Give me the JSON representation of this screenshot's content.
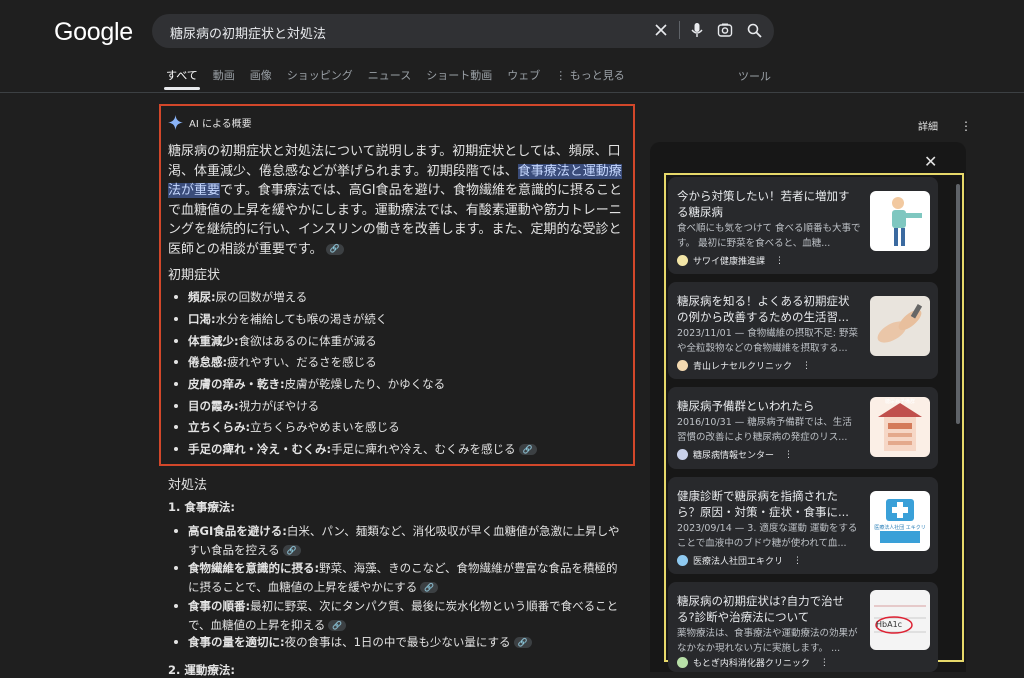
{
  "logo": "Google",
  "search": {
    "query": "糖尿病の初期症状と対処法"
  },
  "tabs": [
    "すべて",
    "動画",
    "画像",
    "ショッピング",
    "ニュース",
    "ショート動画",
    "ウェブ"
  ],
  "more_label": "もっと見る",
  "tools_label": "ツール",
  "ai": {
    "header": "AI による概要",
    "para_part1": "糖尿病の初期症状と対処法について説明します。初期症状としては、頻尿、口渇、体重減少、倦怠感などが挙げられます。初期段階では、",
    "para_highlight": "食事療法と運動療法が重要",
    "para_part2": "です。食事療法では、高GI食品を避け、食物繊維を意識的に摂ることで血糖値の上昇を緩やかにします。運動療法では、有酸素運動や筋力トレーニングを継続的に行い、インスリンの働きを改善します。また、定期的な受診と医師との相談が重要です。",
    "symptoms_title": "初期症状",
    "symptoms": [
      {
        "term": "頻尿:",
        "desc": "尿の回数が増える"
      },
      {
        "term": "口渇:",
        "desc": "水分を補給しても喉の渇きが続く"
      },
      {
        "term": "体重減少:",
        "desc": "食欲はあるのに体重が減る"
      },
      {
        "term": "倦怠感:",
        "desc": "疲れやすい、だるさを感じる"
      },
      {
        "term": "皮膚の痒み・乾き:",
        "desc": "皮膚が乾燥したり、かゆくなる"
      },
      {
        "term": "目の霞み:",
        "desc": "視力がぼやける"
      },
      {
        "term": "立ちくらみ:",
        "desc": "立ちくらみやめまいを感じる"
      },
      {
        "term": "手足の痺れ・冷え・むくみ:",
        "desc": "手足に痺れや冷え、むくみを感じる"
      }
    ],
    "treatment_title": "対処法",
    "diet_title": "1. 食事療法:",
    "diet": [
      {
        "term": "高GI食品を避ける:",
        "desc1": "白米、パン、麺類など、消化吸収が早く血糖値が急激に上昇しや",
        "desc2": "すい食品を控える"
      },
      {
        "term": "食物繊維を意識的に摂る:",
        "desc1": "野菜、海藻、きのこなど、食物繊維が豊富な食品を積極的",
        "desc2": "に摂ることで、血糖値の上昇を緩やかにする"
      },
      {
        "term": "食事の順番:",
        "desc1": "最初に野菜、次にタンパク質、最後に炭水化物という順番で食べること",
        "desc2": "で、血糖値の上昇を抑える"
      },
      {
        "term": "食事の量を適切に:",
        "desc1": "夜の食事は、1日の中で最も少ない量にする",
        "desc2": ""
      }
    ],
    "exercise_title": "2. 運動療法:"
  },
  "panel": {
    "detail_label": "詳細",
    "cards": [
      {
        "title": "今から対策したい！若者に増加する糖尿病",
        "snippet": "食べ順にも気をつけて 食べる順番も大事です。 最初に野菜を食べると、血糖...",
        "source": "サワイ健康推進課"
      },
      {
        "title": "糖尿病を知る！よくある初期症状の例から改善するための生活習...",
        "snippet": "2023/11/01 — 食物繊維の摂取不足: 野菜や全粒穀物などの食物繊維を摂取する...",
        "source": "青山レナセルクリニック"
      },
      {
        "title": "糖尿病予備群といわれたら",
        "snippet": "2016/10/31 — 糖尿病予備群では、生活習慣の改善により糖尿病の発症のリス...",
        "source": "糖尿病情報センター"
      },
      {
        "title": "健康診断で糖尿病を指摘されたら？原因・対策・症状・食事に...",
        "snippet": "2023/09/14 — 3. 適度な運動 運動をすることで血液中のブドウ糖が使われて血...",
        "source": "医療法人社団エキクリ"
      },
      {
        "title": "糖尿病の初期症状は?自力で治せる?診断や治療法について",
        "snippet": "薬物療法は、食事療法や運動療法の効果がなかなか現れない方に実施します。 ...",
        "source": "もとぎ内科消化器クリニック"
      }
    ],
    "thumb3_label": "糖尿病予備群",
    "thumb4_label": "医療法人社団 エキクリ",
    "thumb5_label": "HbA1c"
  }
}
